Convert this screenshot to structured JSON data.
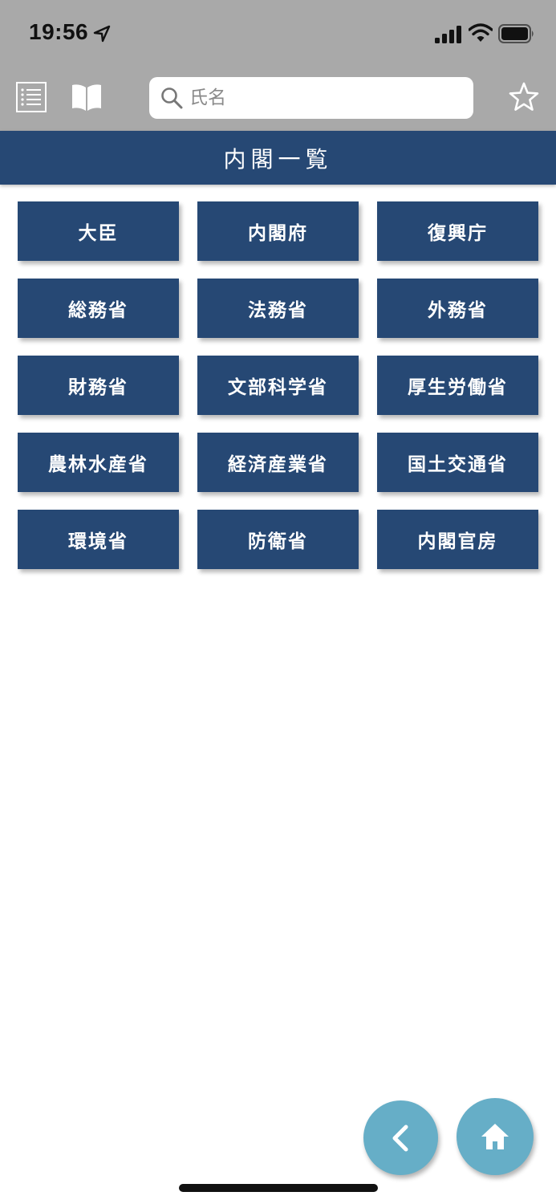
{
  "status_bar": {
    "time": "19:56"
  },
  "toolbar": {
    "search_placeholder": "氏名",
    "icons": [
      "list-icon",
      "book-icon",
      "search-icon",
      "star-icon"
    ]
  },
  "header": {
    "title": "内閣一覧"
  },
  "ministries": [
    "大臣",
    "内閣府",
    "復興庁",
    "総務省",
    "法務省",
    "外務省",
    "財務省",
    "文部科学省",
    "厚生労働省",
    "農林水産省",
    "経済産業省",
    "国土交通省",
    "環境省",
    "防衛省",
    "内閣官房"
  ],
  "navigation": {
    "icons": [
      "back-icon",
      "home-icon"
    ]
  },
  "colors": {
    "toolbar_bg": "#a9a9a9",
    "primary": "#264874",
    "fab": "#66aec7",
    "background": "#ffffff"
  }
}
